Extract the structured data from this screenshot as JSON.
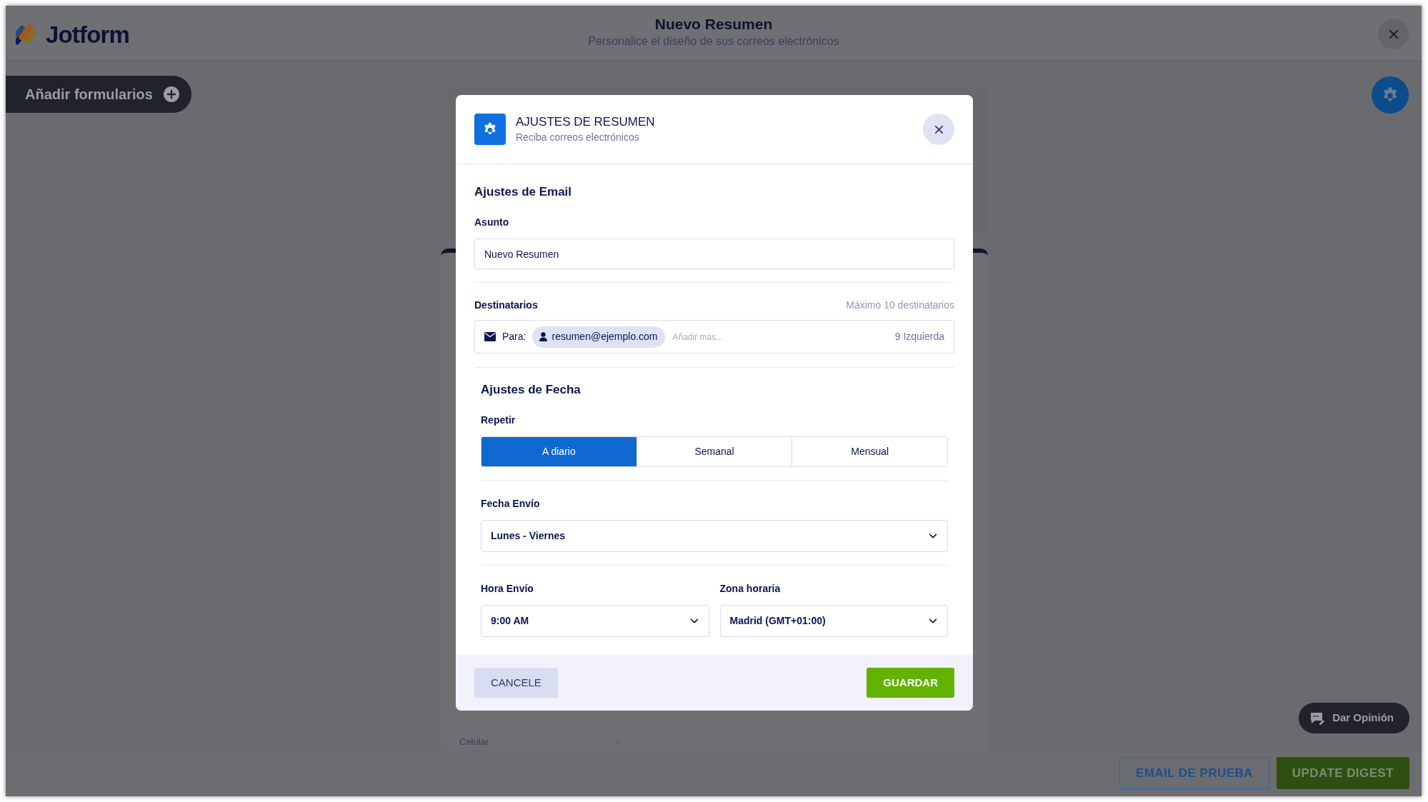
{
  "header": {
    "logo": "Jotform",
    "title": "Nuevo Resumen",
    "subtitle": "Personalice el diseño de sus correos electrónicos"
  },
  "add_forms_button": {
    "label": "Añadir formularios"
  },
  "background_table": {
    "rows": [
      {
        "label": "Celular",
        "value": "-"
      }
    ]
  },
  "feedback_button": {
    "label": "Dar Opinión"
  },
  "footer_buttons": [
    {
      "label": "EMAIL DE PRUEBA",
      "kind": "outline"
    },
    {
      "label": "UPDATE DIGEST",
      "kind": "primary"
    }
  ],
  "dialog": {
    "title": "AJUSTES DE RESUMEN",
    "subtitle": "Reciba correos electrónicos",
    "email_section": {
      "heading": "Ajustes de Email",
      "subject_label": "Asunto",
      "subject_value": "Nuevo Resumen",
      "recipients_label": "Destinatarios",
      "recipients_limit": "Máximo 10 destinatarios",
      "to_label": "Para:",
      "recipients": [
        "resumen@ejemplo.com"
      ],
      "add_placeholder": "Añadir más...",
      "remaining": "9 Izquierda"
    },
    "date_section": {
      "heading": "Ajustes de Fecha",
      "repeat_label": "Repetir",
      "repeat_options": [
        {
          "label": "A diario",
          "selected": true
        },
        {
          "label": "Semanal",
          "selected": false
        },
        {
          "label": "Mensual",
          "selected": false
        }
      ],
      "send_date_label": "Fecha Envío",
      "send_date_value": "Lunes - Viernes",
      "send_time_label": "Hora Envío",
      "send_time_value": "9:00 AM",
      "timezone_label": "Zona horaria",
      "timezone_value": "Madrid (GMT+01:00)"
    },
    "cancel_button": "CANCELE",
    "save_button": "GUARDAR"
  }
}
